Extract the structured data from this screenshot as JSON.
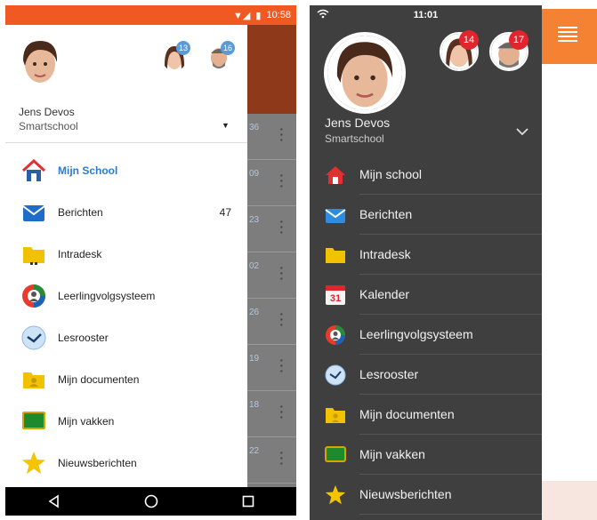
{
  "android": {
    "status_time": "10:58",
    "user": {
      "name": "Jens Devos",
      "school": "Smartschool"
    },
    "badges": [
      "13",
      "16"
    ],
    "bg_numbers": [
      "36",
      "09",
      "23",
      "02",
      "26",
      "19",
      "18",
      "22"
    ],
    "menu": [
      {
        "label": "Mijn School",
        "active": true,
        "icon": "house-icon"
      },
      {
        "label": "Berichten",
        "count": "47",
        "icon": "envelope-icon"
      },
      {
        "label": "Intradesk",
        "icon": "folder-icon"
      },
      {
        "label": "Leerlingvolgsysteem",
        "icon": "lvs-icon"
      },
      {
        "label": "Lesrooster",
        "icon": "clock-icon"
      },
      {
        "label": "Mijn documenten",
        "icon": "documents-folder-icon"
      },
      {
        "label": "Mijn vakken",
        "icon": "chalkboard-icon"
      },
      {
        "label": "Nieuwsberichten",
        "icon": "star-icon"
      }
    ]
  },
  "ios": {
    "status_time": "11:01",
    "user": {
      "name": "Jens Devos",
      "school": "Smartschool"
    },
    "badges": [
      "14",
      "17"
    ],
    "calendar_day": "31",
    "menu": [
      {
        "label": "Mijn school",
        "icon": "house-icon"
      },
      {
        "label": "Berichten",
        "icon": "envelope-icon"
      },
      {
        "label": "Intradesk",
        "icon": "folder-icon"
      },
      {
        "label": "Kalender",
        "icon": "calendar-icon"
      },
      {
        "label": "Leerlingvolgsysteem",
        "icon": "lvs-icon"
      },
      {
        "label": "Lesrooster",
        "icon": "clock-icon"
      },
      {
        "label": "Mijn documenten",
        "icon": "documents-folder-icon"
      },
      {
        "label": "Mijn vakken",
        "icon": "chalkboard-icon"
      },
      {
        "label": "Nieuwsberichten",
        "icon": "star-icon"
      }
    ]
  },
  "colors": {
    "android_accent": "#f05a22",
    "ios_accent": "#f58233",
    "active_link": "#2c7bd0",
    "badge_blue": "#5b9bd5",
    "badge_red": "#e0262c"
  }
}
